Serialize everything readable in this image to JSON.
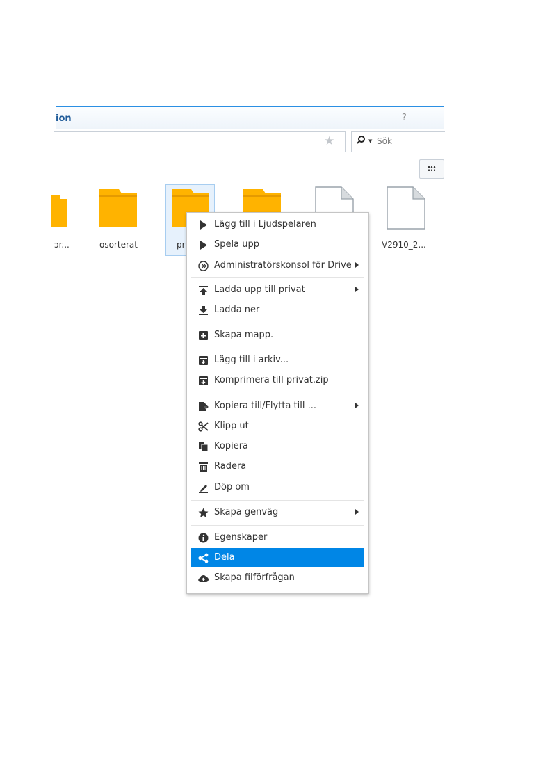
{
  "window": {
    "title_fragment": "ion",
    "help_glyph": "?",
    "minimize_glyph": "—",
    "search": {
      "placeholder": "Sök"
    }
  },
  "files": [
    {
      "label": "ɔr...",
      "kind": "folder"
    },
    {
      "label": "osorterat",
      "kind": "folder"
    },
    {
      "label": "pr",
      "kind": "folder",
      "selected": true
    },
    {
      "label": "",
      "kind": "folder"
    },
    {
      "label": "",
      "kind": "file"
    },
    {
      "label": "V2910_2...",
      "kind": "file"
    }
  ],
  "context_menu": {
    "items": [
      {
        "label": "Lägg till i Ljudspelaren",
        "icon": "play-icon"
      },
      {
        "label": "Spela upp",
        "icon": "play-icon"
      },
      {
        "label": "Administratörskonsol för Drive",
        "icon": "drive-icon",
        "submenu": true
      },
      {
        "label": "Ladda upp till privat",
        "icon": "upload-icon",
        "submenu": true
      },
      {
        "label": "Ladda ner",
        "icon": "download-icon"
      },
      {
        "label": "Skapa mapp.",
        "icon": "new-folder-icon"
      },
      {
        "label": "Lägg till i arkiv...",
        "icon": "archive-icon"
      },
      {
        "label": "Komprimera till privat.zip",
        "icon": "archive-icon"
      },
      {
        "label": "Kopiera till/Flytta till ...",
        "icon": "copy-move-icon",
        "submenu": true
      },
      {
        "label": "Klipp ut",
        "icon": "scissors-icon"
      },
      {
        "label": "Kopiera",
        "icon": "copy-icon"
      },
      {
        "label": "Radera",
        "icon": "trash-icon"
      },
      {
        "label": "Döp om",
        "icon": "rename-pencil-icon"
      },
      {
        "label": "Skapa genväg",
        "icon": "star-icon",
        "submenu": true
      },
      {
        "label": "Egenskaper",
        "icon": "info-icon"
      },
      {
        "label": "Dela",
        "icon": "share-icon",
        "active": true
      },
      {
        "label": "Skapa filförfrågan",
        "icon": "cloud-upload-icon"
      }
    ]
  },
  "colors": {
    "accent": "#0086e6",
    "folder": "#ffb300",
    "title": "#1f5b99"
  }
}
